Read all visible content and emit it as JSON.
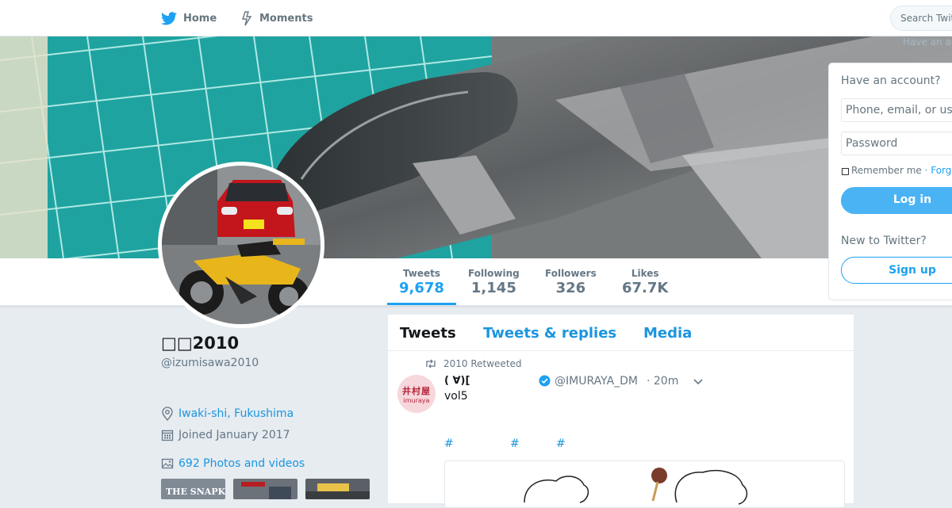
{
  "topnav": {
    "home_label": "Home",
    "moments_label": "Moments",
    "search_placeholder": "Search Twitter",
    "have_account_small": "Have an account?"
  },
  "profile_nav": {
    "stats": [
      {
        "label": "Tweets",
        "value": "9,678",
        "active": true
      },
      {
        "label": "Following",
        "value": "1,145"
      },
      {
        "label": "Followers",
        "value": "326"
      },
      {
        "label": "Likes",
        "value": "67.7K"
      }
    ]
  },
  "profile": {
    "fullname": "□□2010",
    "screenname": "@izumisawa2010",
    "location": "Iwaki-shi, Fukushima",
    "joined": "Joined January 2017",
    "photos_link": "692 Photos and videos",
    "thumb_captions": [
      "THE SNAPKIT",
      "",
      ""
    ]
  },
  "timeline": {
    "tabs": [
      "Tweets",
      "Tweets & replies",
      "Media"
    ],
    "tweet": {
      "retweet_context": "2010 Retweeted",
      "avatar_text_jp": "井村屋",
      "avatar_text_en": "imuraya",
      "name": "( ∀)[",
      "handle": "@IMURAYA_DM",
      "time": "· 20m",
      "text": "vol5",
      "hashtags": [
        "#",
        "#",
        "#"
      ]
    }
  },
  "login": {
    "heading": "Have an account?",
    "phone_placeholder": "Phone, email, or username",
    "password_placeholder": "Password",
    "remember": "Remember me",
    "forgot": "· Forgot password?",
    "login_button": "Log in",
    "new_heading": "New to Twitter?",
    "signup_button": "Sign up"
  },
  "colors": {
    "accent": "#1da1f2",
    "link": "#1b95e0",
    "background": "#e6ecf0"
  },
  "icons": [
    "twitter-bird-icon",
    "moments-bolt-icon",
    "location-pin-icon",
    "calendar-icon",
    "photo-icon",
    "retweet-icon",
    "verified-icon",
    "chevron-down-icon"
  ]
}
